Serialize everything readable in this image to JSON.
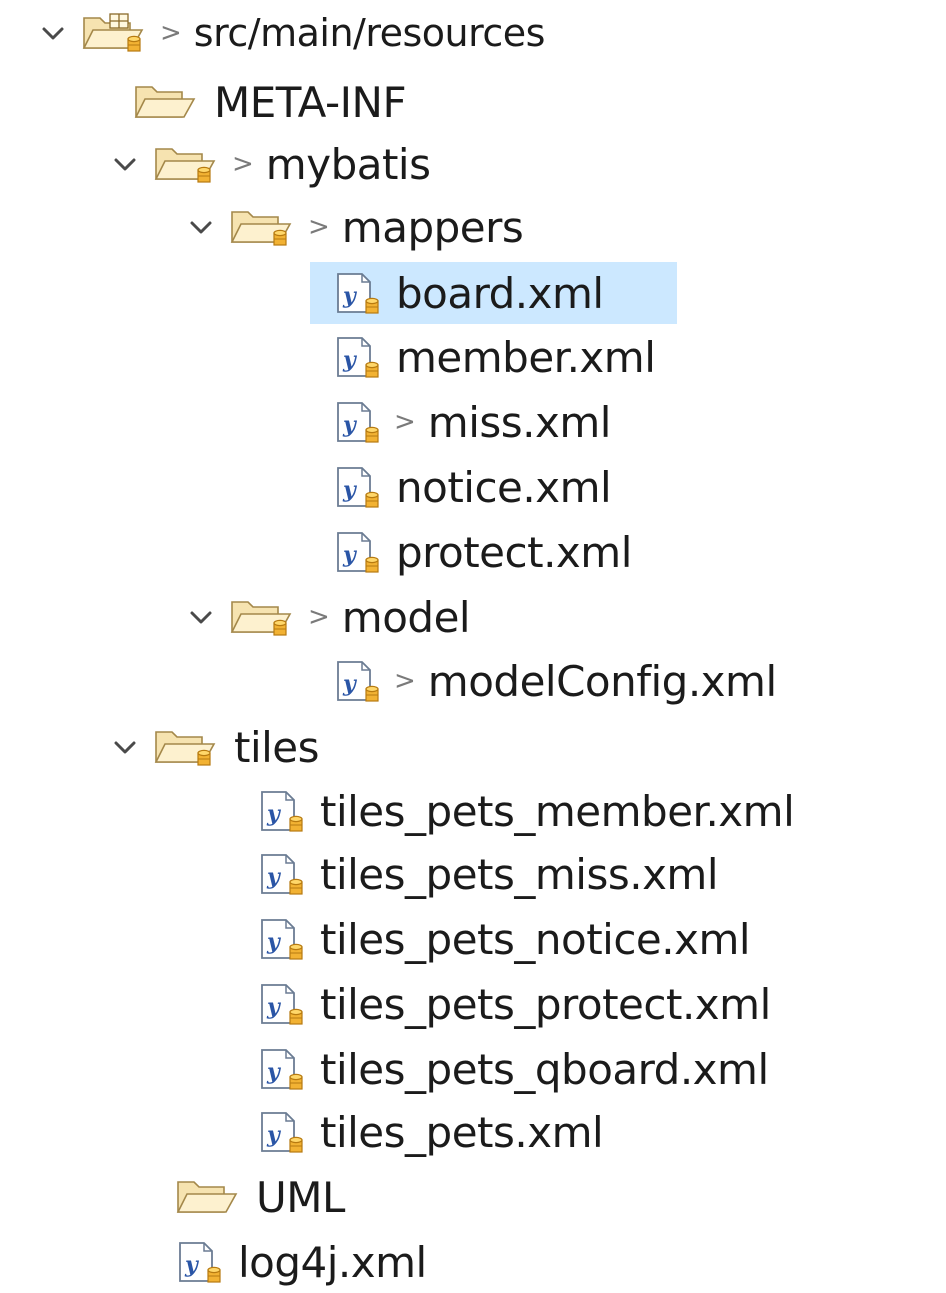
{
  "selection_color": "#cce8ff",
  "tree": [
    {
      "id": "src-main-resources",
      "label": "src/main/resources",
      "icon": "source-folder-icon",
      "expanded": true,
      "dirty": true,
      "selected": false
    },
    {
      "id": "meta-inf",
      "label": "META-INF",
      "icon": "folder-icon",
      "expanded": null,
      "dirty": false,
      "selected": false
    },
    {
      "id": "mybatis",
      "label": "mybatis",
      "icon": "package-folder-icon",
      "expanded": true,
      "dirty": true,
      "selected": false
    },
    {
      "id": "mappers",
      "label": "mappers",
      "icon": "package-folder-icon",
      "expanded": true,
      "dirty": true,
      "selected": false
    },
    {
      "id": "board-xml",
      "label": "board.xml",
      "icon": "xml-file-icon",
      "expanded": null,
      "dirty": false,
      "selected": true
    },
    {
      "id": "member-xml",
      "label": "member.xml",
      "icon": "xml-file-icon",
      "expanded": null,
      "dirty": false,
      "selected": false
    },
    {
      "id": "miss-xml",
      "label": "miss.xml",
      "icon": "xml-file-icon",
      "expanded": null,
      "dirty": true,
      "selected": false
    },
    {
      "id": "notice-xml",
      "label": "notice.xml",
      "icon": "xml-file-icon",
      "expanded": null,
      "dirty": false,
      "selected": false
    },
    {
      "id": "protect-xml",
      "label": "protect.xml",
      "icon": "xml-file-icon",
      "expanded": null,
      "dirty": false,
      "selected": false
    },
    {
      "id": "model",
      "label": "model",
      "icon": "package-folder-icon",
      "expanded": true,
      "dirty": true,
      "selected": false
    },
    {
      "id": "modelconfig-xml",
      "label": "modelConfig.xml",
      "icon": "xml-file-icon",
      "expanded": null,
      "dirty": true,
      "selected": false
    },
    {
      "id": "tiles",
      "label": "tiles",
      "icon": "package-folder-icon",
      "expanded": true,
      "dirty": false,
      "selected": false
    },
    {
      "id": "tiles-pets-member-xml",
      "label": "tiles_pets_member.xml",
      "icon": "xml-file-icon",
      "expanded": null,
      "dirty": false,
      "selected": false
    },
    {
      "id": "tiles-pets-miss-xml",
      "label": "tiles_pets_miss.xml",
      "icon": "xml-file-icon",
      "expanded": null,
      "dirty": false,
      "selected": false
    },
    {
      "id": "tiles-pets-notice-xml",
      "label": "tiles_pets_notice.xml",
      "icon": "xml-file-icon",
      "expanded": null,
      "dirty": false,
      "selected": false
    },
    {
      "id": "tiles-pets-protect-xml",
      "label": "tiles_pets_protect.xml",
      "icon": "xml-file-icon",
      "expanded": null,
      "dirty": false,
      "selected": false
    },
    {
      "id": "tiles-pets-qboard-xml",
      "label": "tiles_pets_qboard.xml",
      "icon": "xml-file-icon",
      "expanded": null,
      "dirty": false,
      "selected": false
    },
    {
      "id": "tiles-pets-xml",
      "label": "tiles_pets.xml",
      "icon": "xml-file-icon",
      "expanded": null,
      "dirty": false,
      "selected": false
    },
    {
      "id": "uml",
      "label": "UML",
      "icon": "folder-icon",
      "expanded": null,
      "dirty": false,
      "selected": false
    },
    {
      "id": "log4j-xml",
      "label": "log4j.xml",
      "icon": "xml-file-icon",
      "expanded": null,
      "dirty": false,
      "selected": false
    }
  ],
  "dirty_marker": ">"
}
